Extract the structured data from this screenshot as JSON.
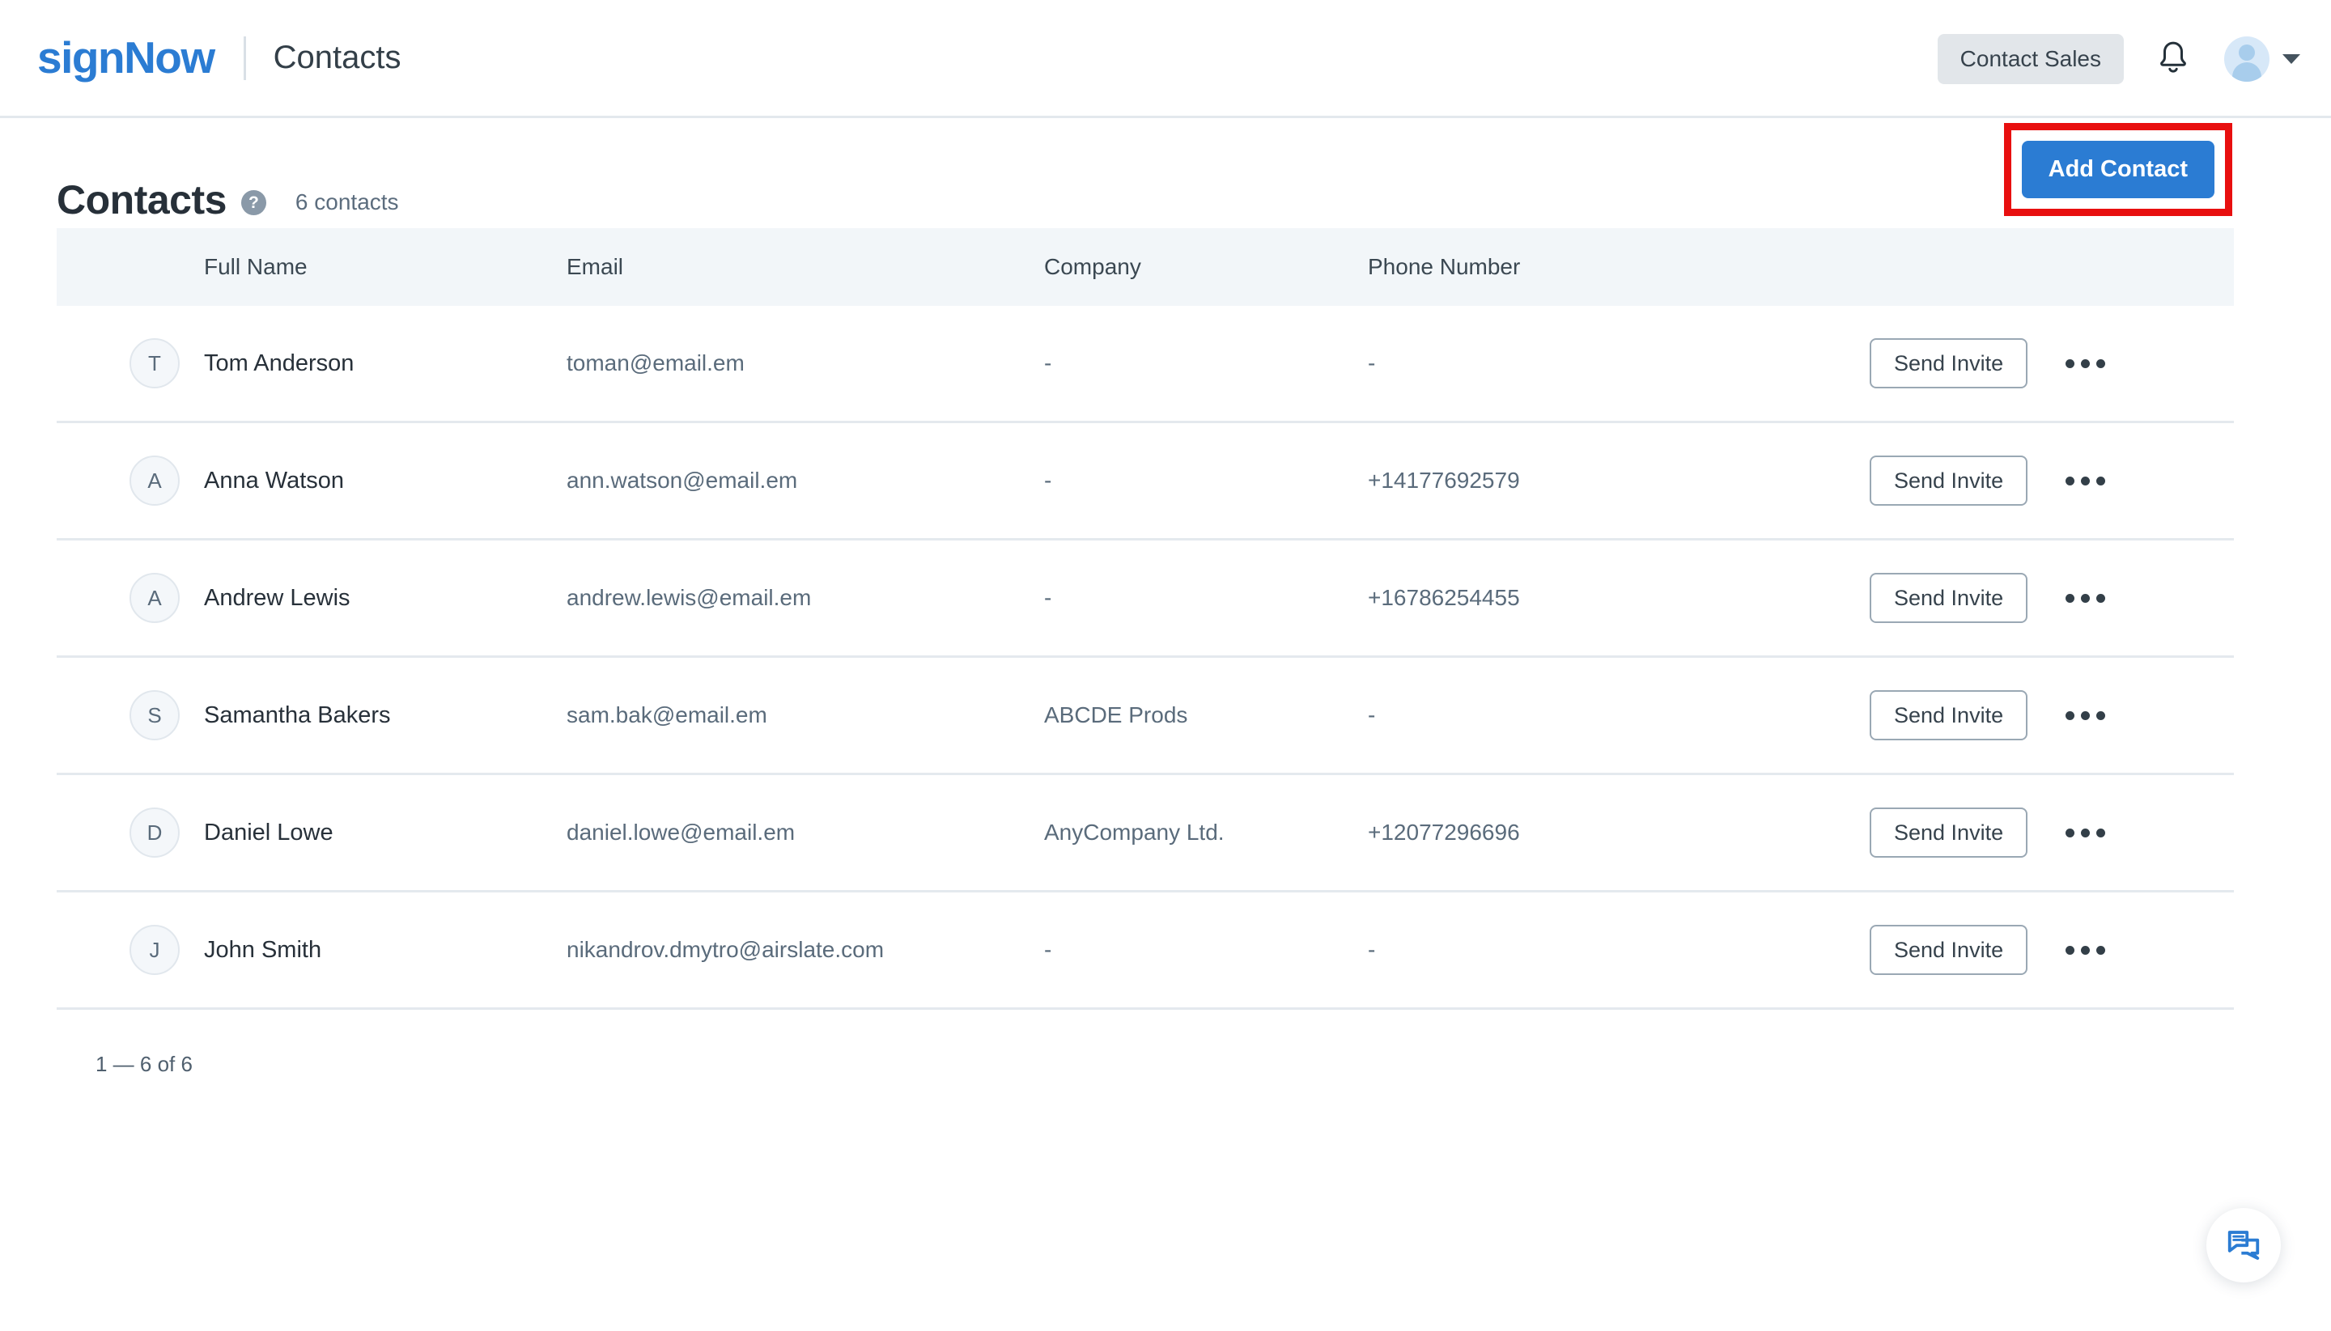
{
  "header": {
    "logo_sign": "sign",
    "logo_now": "Now",
    "page_label": "Contacts",
    "contact_sales_label": "Contact Sales",
    "bell_icon": "bell-icon",
    "avatar_icon": "user-avatar-icon",
    "caret_icon": "chevron-down-icon"
  },
  "page": {
    "title": "Contacts",
    "help_icon_glyph": "?",
    "contacts_count": "6 contacts",
    "add_contact_label": "Add Contact",
    "pagination": "1 — 6 of 6"
  },
  "colors": {
    "brand_blue": "#2b7cd3",
    "annotation_red": "#e80f0f",
    "table_header_bg": "#f2f6f9",
    "muted_text": "#5a6b7b"
  },
  "table": {
    "columns": [
      "Full Name",
      "Email",
      "Company",
      "Phone Number"
    ],
    "row_action_label": "Send Invite",
    "row_menu_icon": "ellipsis-icon",
    "rows": [
      {
        "initial": "T",
        "name": "Tom Anderson",
        "email": "toman@email.em",
        "company": "-",
        "phone": "-"
      },
      {
        "initial": "A",
        "name": "Anna Watson",
        "email": "ann.watson@email.em",
        "company": "-",
        "phone": "+14177692579"
      },
      {
        "initial": "A",
        "name": "Andrew Lewis",
        "email": "andrew.lewis@email.em",
        "company": "-",
        "phone": "+16786254455"
      },
      {
        "initial": "S",
        "name": "Samantha Bakers",
        "email": "sam.bak@email.em",
        "company": "ABCDE Prods",
        "phone": "-"
      },
      {
        "initial": "D",
        "name": "Daniel Lowe",
        "email": "daniel.lowe@email.em",
        "company": "AnyCompany Ltd.",
        "phone": "+12077296696"
      },
      {
        "initial": "J",
        "name": "John Smith",
        "email": "nikandrov.dmytro@airslate.com",
        "company": "-",
        "phone": "-"
      }
    ]
  },
  "chat_fab": {
    "icon": "chat-bubbles-icon"
  }
}
